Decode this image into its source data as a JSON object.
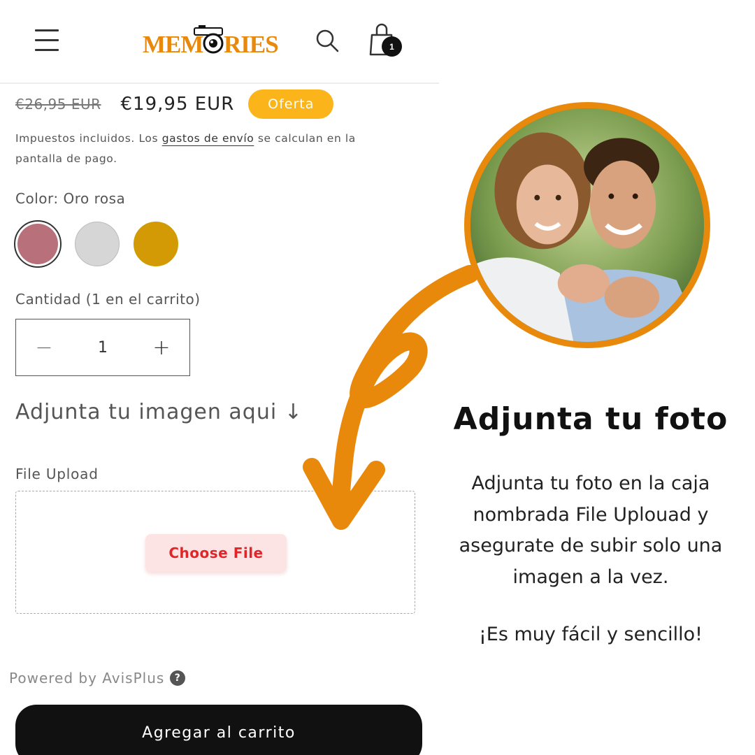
{
  "header": {
    "menu_icon": "hamburger-menu-icon",
    "logo_text": "MEMORIES",
    "search_icon": "search-icon",
    "cart_icon": "shopping-bag-icon",
    "cart_count": "1"
  },
  "product": {
    "price_old": "€26,95 EUR",
    "price_new": "€19,95 EUR",
    "sale_badge": "Oferta",
    "tax_note_prefix": "Impuestos incluidos. Los ",
    "tax_note_link": "gastos de envío",
    "tax_note_suffix": " se calculan en la pantalla de pago.",
    "color_label": "Color: Oro rosa",
    "swatches": [
      {
        "name": "Oro rosa",
        "color": "#b8707a",
        "selected": true
      },
      {
        "name": "Plata",
        "color": "#d6d6d6",
        "selected": false
      },
      {
        "name": "Oro",
        "color": "#d49a06",
        "selected": false
      }
    ],
    "quantity_label": "Cantidad (1 en el carrito)",
    "quantity_minus": "−",
    "quantity_value": "1",
    "quantity_plus": "+",
    "attach_heading": "Adjunta tu imagen aqui ↓",
    "upload_label": "File Upload",
    "choose_file": "Choose File",
    "powered_by": "Powered by AvisPlus",
    "help_icon": "question-circle-icon",
    "add_to_cart": "Agregar al carrito"
  },
  "promo": {
    "title": "Adjunta tu foto",
    "body": "Adjunta tu foto en la caja nombrada File Uplouad y asegurate de subir solo una imagen a la vez.",
    "closer": "¡Es muy fácil y sencillo!",
    "accent_color": "#e8890c"
  }
}
